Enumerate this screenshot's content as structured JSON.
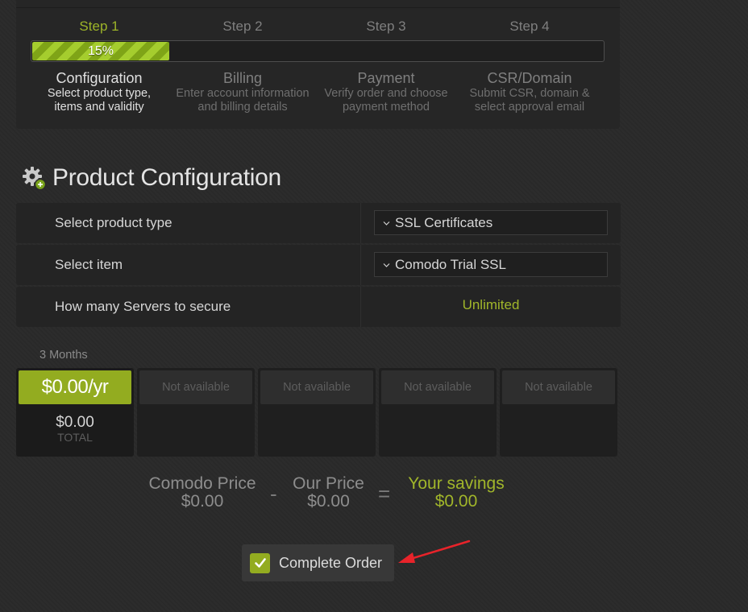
{
  "steps": [
    {
      "label": "Step 1",
      "title": "Configuration",
      "desc_line1": "Select product type,",
      "desc_line2": "items and validity",
      "active": true
    },
    {
      "label": "Step 2",
      "title": "Billing",
      "desc_line1": "Enter account information",
      "desc_line2": "and billing details",
      "active": false
    },
    {
      "label": "Step 3",
      "title": "Payment",
      "desc_line1": "Verify order and choose",
      "desc_line2": "payment method",
      "active": false
    },
    {
      "label": "Step 4",
      "title": "CSR/Domain",
      "desc_line1": "Submit CSR, domain &",
      "desc_line2": "select approval email",
      "active": false
    }
  ],
  "progress": {
    "text": "15%",
    "percent": 15
  },
  "section": {
    "title": "Product Configuration",
    "icon": "gear-add-icon"
  },
  "config": {
    "product_type_label": "Select product type",
    "product_type_value": "SSL Certificates",
    "item_label": "Select item",
    "item_value": "Comodo Trial SSL",
    "servers_label": "How many Servers to secure",
    "servers_value": "Unlimited"
  },
  "pricing": {
    "period": "3 Months",
    "selected_price": "$0.00/yr",
    "selected_total": "$0.00",
    "total_label": "TOTAL",
    "unavailable_label": "Not available"
  },
  "summary": {
    "comodo_label": "Comodo Price",
    "comodo_value": "$0.00",
    "minus": "-",
    "our_label": "Our Price",
    "our_value": "$0.00",
    "equals": "=",
    "savings_label": "Your savings",
    "savings_value": "$0.00"
  },
  "complete_order": {
    "label": "Complete Order",
    "checked": true
  },
  "colors": {
    "accent": "#93ac20",
    "accent_text": "#a1b62a",
    "background": "#2a2a2a",
    "annotation_arrow": "#e8232a"
  }
}
